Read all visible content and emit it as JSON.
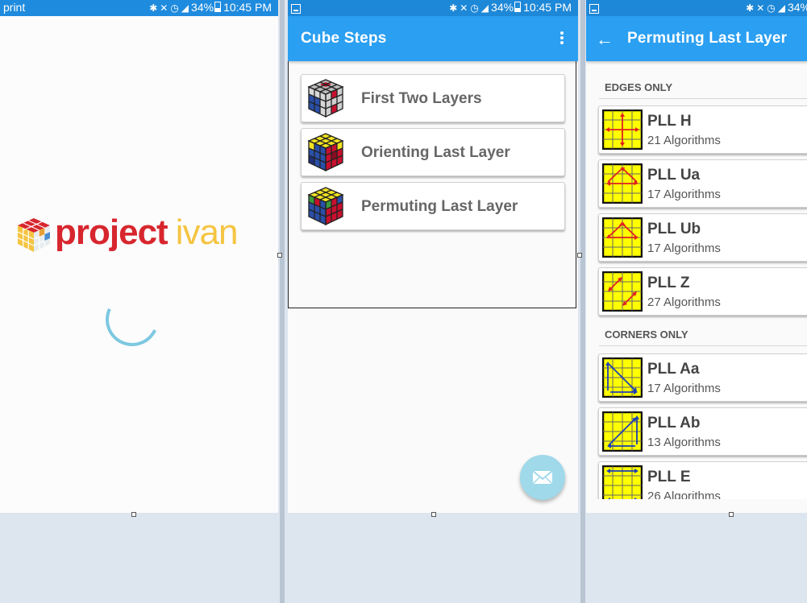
{
  "status": {
    "carrier": "print",
    "battery": "34%",
    "time": "10:45 PM"
  },
  "splash": {
    "logo_word1": "project",
    "logo_word2": "ivan"
  },
  "cube_steps": {
    "title": "Cube Steps",
    "items": [
      {
        "label": "First Two Layers",
        "icon": "f2l-cube-icon"
      },
      {
        "label": "Orienting Last Layer",
        "icon": "oll-cube-icon"
      },
      {
        "label": "Permuting Last Layer",
        "icon": "pll-cube-icon"
      }
    ],
    "fab_icon": "envelope-icon"
  },
  "pll": {
    "title": "Permuting Last Layer",
    "sections": [
      {
        "header": "EDGES ONLY",
        "items": [
          {
            "name": "PLL H",
            "count": "21 Algorithms"
          },
          {
            "name": "PLL Ua",
            "count": "17 Algorithms"
          },
          {
            "name": "PLL Ub",
            "count": "17 Algorithms"
          },
          {
            "name": "PLL Z",
            "count": "27 Algorithms"
          }
        ]
      },
      {
        "header": "CORNERS ONLY",
        "items": [
          {
            "name": "PLL Aa",
            "count": "17 Algorithms"
          },
          {
            "name": "PLL Ab",
            "count": "13 Algorithms"
          },
          {
            "name": "PLL E",
            "count": "26 Algorithms"
          }
        ]
      }
    ]
  },
  "colors": {
    "app_bar": "#2b9ff1",
    "status_bar": "#1e88d8",
    "logo_red": "#d7262e",
    "logo_yellow": "#f5c441",
    "spinner": "#7dc8e1",
    "fab": "#9fd9ea",
    "edge_arrow": "#e02020",
    "corner_arrow": "#1e3fb5",
    "pll_sticker": "#ffff00"
  }
}
